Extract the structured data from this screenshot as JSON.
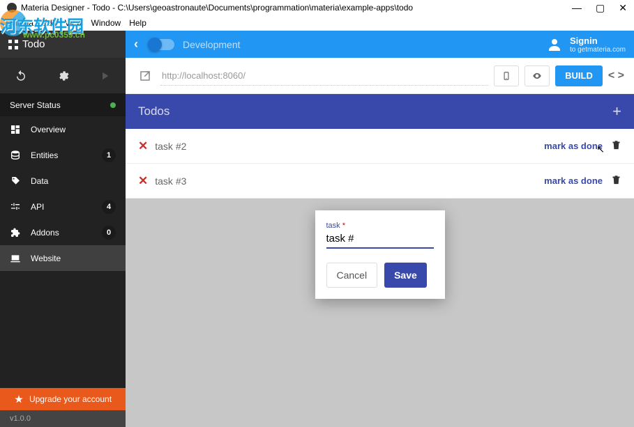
{
  "window": {
    "title": "Materia Designer - Todo - C:\\Users\\geoastronaute\\Documents\\programmation\\materia\\example-apps\\todo"
  },
  "menubar": {
    "items": [
      "Materia",
      "Edit",
      "View",
      "Window",
      "Help"
    ]
  },
  "watermark": {
    "text": "河东软件园",
    "url": "www.pc0359.cn"
  },
  "sidebar": {
    "app_name": "Todo",
    "server_status_label": "Server Status",
    "items": [
      {
        "label": "Overview",
        "badge": null
      },
      {
        "label": "Entities",
        "badge": "1"
      },
      {
        "label": "Data",
        "badge": null
      },
      {
        "label": "API",
        "badge": "4"
      },
      {
        "label": "Addons",
        "badge": "0"
      },
      {
        "label": "Website",
        "badge": null,
        "active": true
      }
    ],
    "upgrade_label": "Upgrade your account",
    "version": "v1.0.0"
  },
  "topbar": {
    "env_label": "Development",
    "signin_title": "Signin",
    "signin_sub": "to getmateria.com"
  },
  "urlbar": {
    "url_value": "http://localhost:8060/",
    "build_label": "BUILD"
  },
  "todos": {
    "header": "Todos",
    "mark_done_label": "mark as done",
    "rows": [
      {
        "task": "task #2"
      },
      {
        "task": "task #3"
      }
    ]
  },
  "modal": {
    "field_label": "task",
    "required_mark": "*",
    "input_value": "task #",
    "cancel_label": "Cancel",
    "save_label": "Save"
  }
}
